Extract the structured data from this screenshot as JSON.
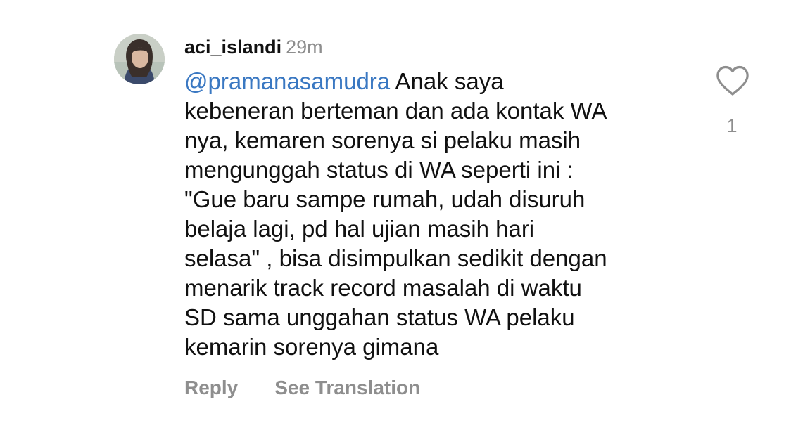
{
  "comment": {
    "username": "aci_islandi",
    "time": "29m",
    "mention": "@pramanasamudra",
    "lines": [
      " Anak saya",
      "kebeneran berteman dan ada kontak WA",
      "nya, kemaren sorenya si pelaku masih",
      "mengunggah status di WA seperti ini :",
      "\"Gue baru sampe rumah, udah disuruh",
      "belaja lagi, pd hal ujian masih hari",
      "selasa\" , bisa disimpulkan sedikit dengan",
      "menarik track record masalah di waktu",
      "SD sama unggahan status WA pelaku",
      "kemarin sorenya gimana"
    ],
    "actions": {
      "reply_label": "Reply",
      "translate_label": "See Translation"
    },
    "likes": {
      "icon": "heart-outline-icon",
      "count": "1"
    },
    "avatar": {
      "icon": "profile-photo"
    }
  },
  "colors": {
    "text": "#111111",
    "muted": "#8e8e8e",
    "mention": "#3a78c2",
    "background": "#ffffff"
  }
}
